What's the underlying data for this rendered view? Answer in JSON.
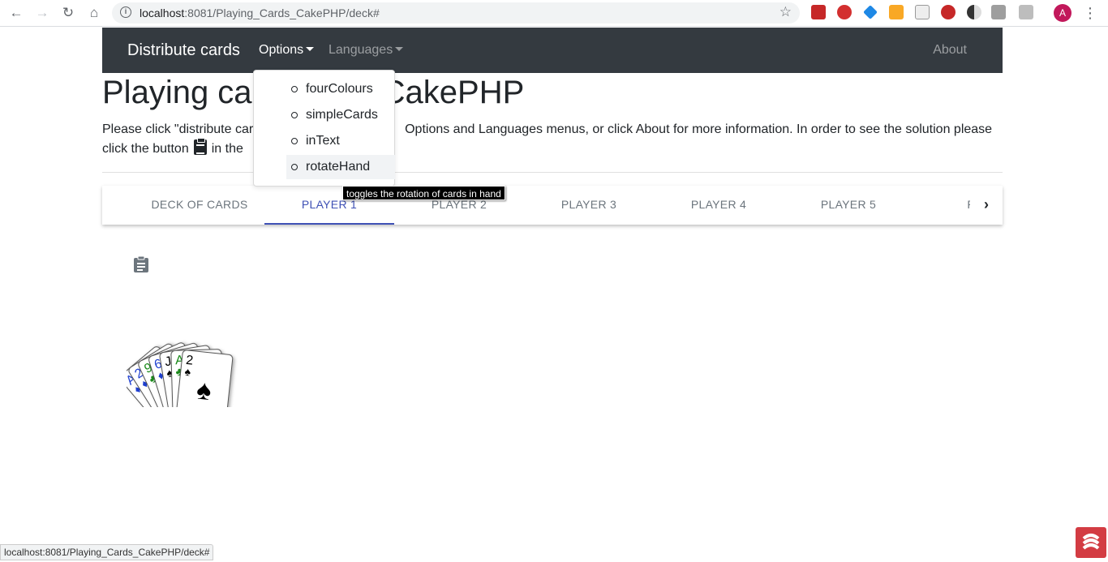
{
  "browser": {
    "url_host": "localhost",
    "url_rest": ":8081/Playing_Cards_CakePHP/deck#",
    "profile_initial": "A",
    "status_url": "localhost:8081/Playing_Cards_CakePHP/deck#"
  },
  "navbar": {
    "brand": "Distribute cards",
    "options": "Options",
    "languages": "Languages",
    "about": "About"
  },
  "page": {
    "heading": "Playing ca          1.1 with CakePHP",
    "intro_part1": "Please click \"distribute card",
    "intro_part2": "Options and Languages menus, or click About for more information. In order to see the solution please",
    "intro_part3": "click the button",
    "intro_part4": "in the"
  },
  "tabs": [
    {
      "label": "DECK OF CARDS"
    },
    {
      "label": "PLAYER 1"
    },
    {
      "label": "PLAYER 2"
    },
    {
      "label": "PLAYER 3"
    },
    {
      "label": "PLAYER 4"
    },
    {
      "label": "PLAYER 5"
    },
    {
      "label": "PLA"
    }
  ],
  "options_menu": [
    {
      "label": "fourColours"
    },
    {
      "label": "simpleCards"
    },
    {
      "label": "inText"
    },
    {
      "label": "rotateHand"
    }
  ],
  "tooltip": "toggles the rotation of cards in hand",
  "hand": [
    {
      "rank": "A",
      "suit": "♦",
      "color": "#1e3fd0"
    },
    {
      "rank": "2",
      "suit": "♦",
      "color": "#1e3fd0"
    },
    {
      "rank": "9",
      "suit": "♣",
      "color": "#1a8a1a"
    },
    {
      "rank": "6",
      "suit": "♦",
      "color": "#1e3fd0"
    },
    {
      "rank": "J",
      "suit": "♠",
      "color": "#000000"
    },
    {
      "rank": "A",
      "suit": "♣",
      "color": "#1a8a1a"
    },
    {
      "rank": "2",
      "suit": "♠",
      "color": "#000000"
    }
  ],
  "colors": {
    "navbar_bg": "#343a40",
    "active_tab": "#3f51b5"
  }
}
